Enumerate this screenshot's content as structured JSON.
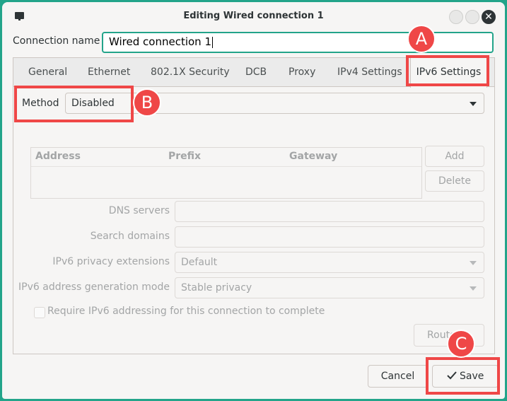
{
  "window": {
    "title": "Editing Wired connection 1",
    "close_glyph": "✕"
  },
  "connection": {
    "label": "Connection name",
    "value": "Wired connection 1"
  },
  "tabs": [
    {
      "label": "General"
    },
    {
      "label": "Ethernet"
    },
    {
      "label": "802.1X Security"
    },
    {
      "label": "DCB"
    },
    {
      "label": "Proxy"
    },
    {
      "label": "IPv4 Settings"
    },
    {
      "label": "IPv6 Settings"
    }
  ],
  "ipv6": {
    "method_label": "Method",
    "method_value": "Disabled",
    "table_headers": [
      "Address",
      "Prefix",
      "Gateway"
    ],
    "add_label": "Add",
    "delete_label": "Delete",
    "dns_label": "DNS servers",
    "search_label": "Search domains",
    "privacy_label": "IPv6 privacy extensions",
    "privacy_value": "Default",
    "addrgen_label": "IPv6 address generation mode",
    "addrgen_value": "Stable privacy",
    "require_label": "Require IPv6 addressing for this connection to complete",
    "routes_label": "Routes…"
  },
  "footer": {
    "cancel_label": "Cancel",
    "save_label": "Save",
    "save_icon": "checkmark-icon"
  },
  "annotations": {
    "a": "A",
    "b": "B",
    "c": "C"
  },
  "colors": {
    "background": "#23a48a",
    "annotation": "#ef4747",
    "focus": "#23a48a"
  }
}
